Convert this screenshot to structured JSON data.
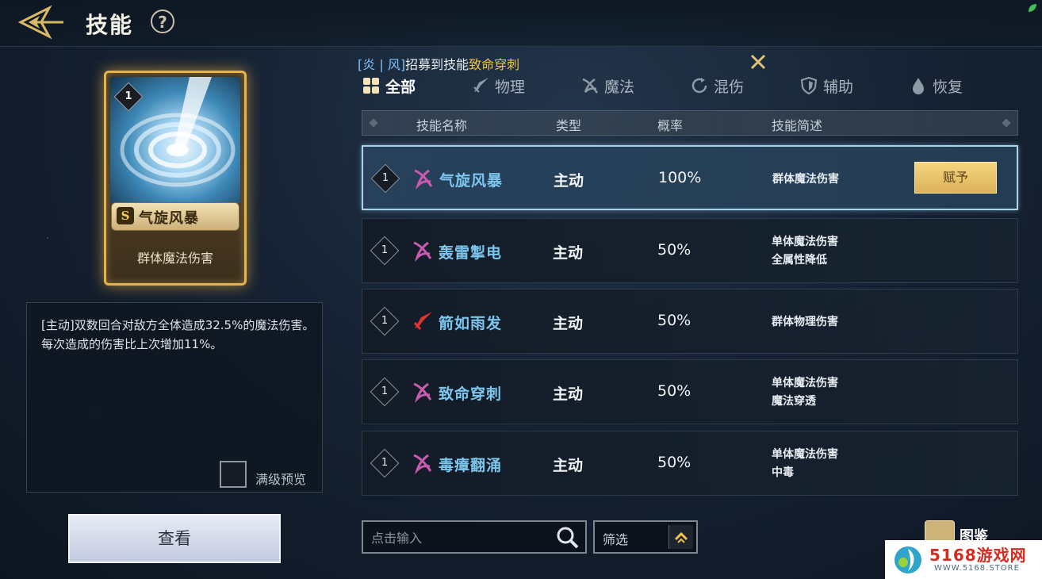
{
  "header": {
    "title": "技能",
    "help_label": "?"
  },
  "card": {
    "level": "1",
    "rarity": "S",
    "name": "气旋风暴",
    "description": "群体魔法伤害"
  },
  "detail": {
    "text": "[主动]双数回合对敌方全体造成32.5%的魔法伤害。每次造成的伤害比上次增加11%。",
    "preview_label": "满级预览",
    "preview_checked": false
  },
  "view_button": "查看",
  "recruit": {
    "bracket_open": "[",
    "names": "炎 | 风",
    "bracket_close": "]",
    "text": "招募到技能",
    "skill": "致命穿刺"
  },
  "tabs": [
    {
      "label": "全部",
      "icon": "grid-icon",
      "active": true
    },
    {
      "label": "物理",
      "icon": "sword-icon",
      "active": false
    },
    {
      "label": "魔法",
      "icon": "magic-icon",
      "active": false
    },
    {
      "label": "混伤",
      "icon": "cycle-icon",
      "active": false
    },
    {
      "label": "辅助",
      "icon": "shield-icon",
      "active": false
    },
    {
      "label": "恢复",
      "icon": "drop-icon",
      "active": false
    }
  ],
  "table": {
    "columns": [
      "技能名称",
      "类型",
      "概率",
      "技能简述"
    ],
    "rows": [
      {
        "level": "1",
        "icon": "magic-skill-icon",
        "name": "气旋风暴",
        "type": "主动",
        "prob": "100%",
        "desc1": "群体魔法伤害",
        "desc2": "",
        "selected": true
      },
      {
        "level": "1",
        "icon": "magic-skill-icon",
        "name": "轰雷掣电",
        "type": "主动",
        "prob": "50%",
        "desc1": "单体魔法伤害",
        "desc2": "全属性降低",
        "selected": false
      },
      {
        "level": "1",
        "icon": "physical-skill-icon",
        "name": "箭如雨发",
        "type": "主动",
        "prob": "50%",
        "desc1": "群体物理伤害",
        "desc2": "",
        "selected": false
      },
      {
        "level": "1",
        "icon": "magic-skill-icon",
        "name": "致命穿刺",
        "type": "主动",
        "prob": "50%",
        "desc1": "单体魔法伤害",
        "desc2": "魔法穿透",
        "selected": false
      },
      {
        "level": "1",
        "icon": "magic-skill-icon",
        "name": "毒瘴翻涌",
        "type": "主动",
        "prob": "50%",
        "desc1": "单体魔法伤害",
        "desc2": "中毒",
        "selected": false
      }
    ],
    "assign_label": "赋予"
  },
  "search": {
    "placeholder": "点击输入",
    "value": ""
  },
  "filter": {
    "label": "筛选"
  },
  "atlas": {
    "label": "图鉴"
  },
  "watermark": {
    "title": "5168游戏网",
    "sub": "WWW.5168.STORE"
  },
  "colors": {
    "accent_gold": "#f0c24a",
    "skill_name": "#7cc6ee",
    "magic_icon": "#c85bb0",
    "physical_icon": "#e0342e"
  }
}
